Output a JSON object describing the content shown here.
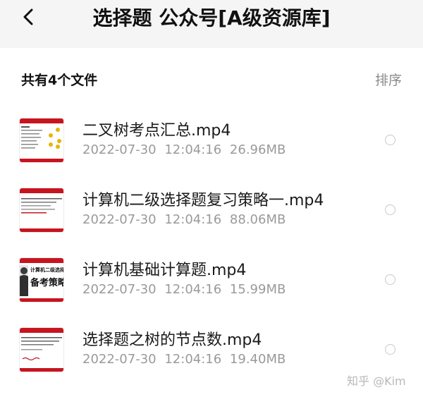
{
  "header": {
    "title": "选择题 公众号[A级资源库]",
    "back_icon": "chevron-left-icon"
  },
  "summary": {
    "count_label": "共有4个文件",
    "sort_label": "排序"
  },
  "files": [
    {
      "name": "二叉树考点汇总.mp4",
      "date": "2022-07-30",
      "time": "12:04:16",
      "size": "26.96MB"
    },
    {
      "name": "计算机二级选择题复习策略一.mp4",
      "date": "2022-07-30",
      "time": "12:04:16",
      "size": "88.06MB"
    },
    {
      "name": "计算机基础计算题.mp4",
      "date": "2022-07-30",
      "time": "12:04:16",
      "size": "15.99MB"
    },
    {
      "name": "选择题之树的节点数.mp4",
      "date": "2022-07-30",
      "time": "12:04:16",
      "size": "19.40MB"
    }
  ],
  "thumbnail_text": {
    "third_line1": "计算机二级选择题",
    "third_line2": "备考策略"
  },
  "watermark": "知乎 @Kim",
  "colors": {
    "header_bg": "#f5f5f5",
    "thumb_red": "#c8141e",
    "meta_gray": "#9a9a9a",
    "sort_gray": "#8a8a8a"
  }
}
